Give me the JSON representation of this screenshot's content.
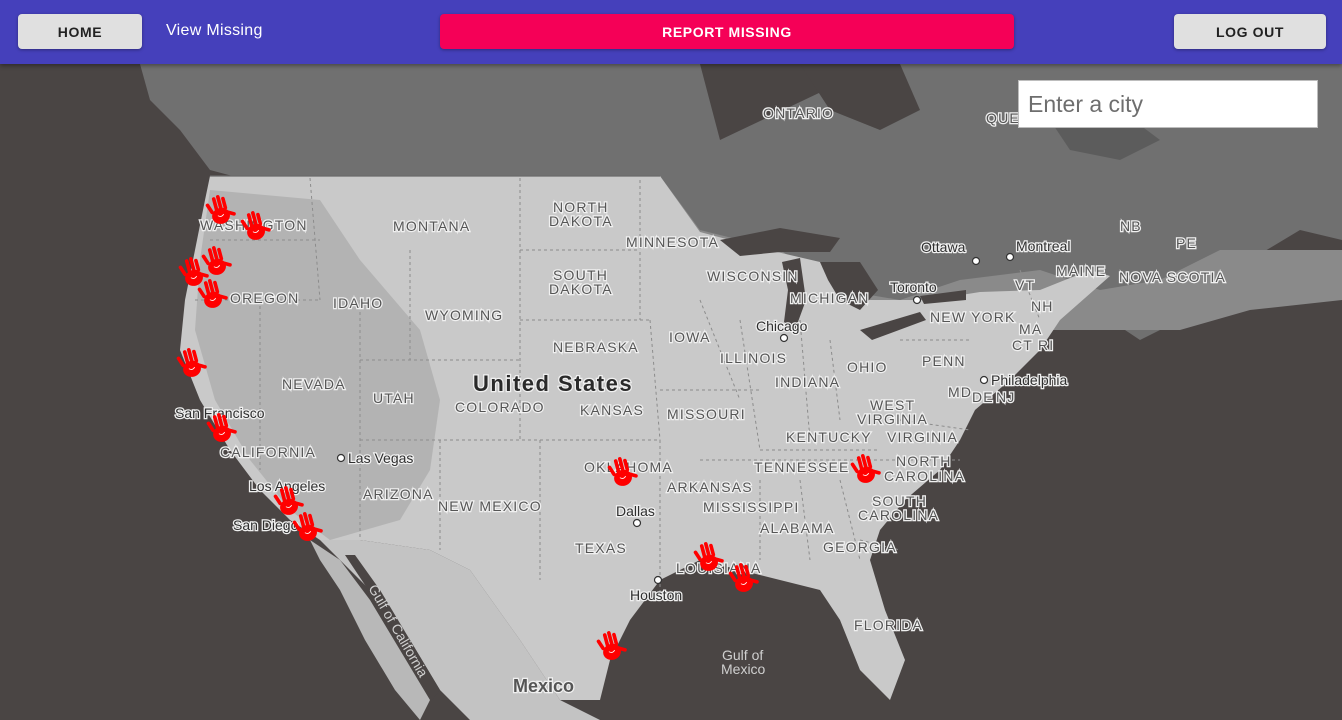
{
  "header": {
    "home_label": "HOME",
    "view_missing_label": "View Missing",
    "report_label": "REPORT MISSING",
    "logout_label": "LOG OUT",
    "accent_color": "#f50057",
    "bar_color": "#4540bb"
  },
  "search": {
    "placeholder": "Enter a city"
  },
  "map": {
    "country_labels": {
      "us": "United States",
      "mexico": "Mexico"
    },
    "state_labels": {
      "washington": "WASHINGTON",
      "montana": "MONTANA",
      "north_dakota_1": "NORTH",
      "north_dakota_2": "DAKOTA",
      "minnesota": "MINNESOTA",
      "oregon": "OREGON",
      "idaho": "IDAHO",
      "wyoming": "WYOMING",
      "south_dakota_1": "SOUTH",
      "south_dakota_2": "DAKOTA",
      "nebraska": "NEBRASKA",
      "iowa": "IOWA",
      "wisconsin": "WISCONSIN",
      "michigan": "MICHIGAN",
      "illinois": "ILLINOIS",
      "indiana": "INDIANA",
      "ohio": "OHIO",
      "penn": "PENN",
      "nevada": "NEVADA",
      "utah": "UTAH",
      "colorado": "COLORADO",
      "kansas": "KANSAS",
      "missouri": "MISSOURI",
      "california": "CALIFORNIA",
      "arizona": "ARIZONA",
      "new_mexico": "NEW MEXICO",
      "oklahoma": "OKLAHOMA",
      "arkansas": "ARKANSAS",
      "texas": "TEXAS",
      "tennessee": "TENNESSEE",
      "kentucky": "KENTUCKY",
      "west_virginia_1": "WEST",
      "west_virginia_2": "VIRGINIA",
      "virginia": "VIRGINIA",
      "north_carolina_1": "NORTH",
      "north_carolina_2": "CAROLINA",
      "south_carolina_1": "SOUTH",
      "south_carolina_2": "CAROLINA",
      "mississippi": "MISSISSIPPI",
      "alabama": "ALABAMA",
      "georgia": "GEORGIA",
      "louisiana": "LOUISIANA",
      "florida": "FLORIDA",
      "new_york": "NEW YORK",
      "vt": "VT",
      "nh": "NH",
      "ma": "MA",
      "ct": "CT",
      "ri": "RI",
      "md": "MD",
      "de": "DE",
      "nj": "NJ",
      "maine": "MAINE",
      "nb": "NB",
      "pe": "PE",
      "nova_scotia": "NOVA SCOTIA",
      "ontario": "ONTARIO",
      "quebec_partial": "QUE"
    },
    "city_labels": {
      "chicago": "Chicago",
      "ottawa": "Ottawa",
      "montreal": "Montreal",
      "toronto": "Toronto",
      "philadelphia": "Philadelphia",
      "san_francisco": "San Francisco",
      "las_vegas": "Las Vegas",
      "los_angeles": "Los Angeles",
      "san_diego": "San Diego",
      "dallas": "Dallas",
      "houston": "Houston"
    },
    "water_labels": {
      "gulf_mexico_1": "Gulf of",
      "gulf_mexico_2": "Mexico",
      "gulf_california": "Gulf of California"
    },
    "marker_icon": "red-handprint-icon",
    "marker_color": "#ff0000",
    "marker_count": 14
  }
}
